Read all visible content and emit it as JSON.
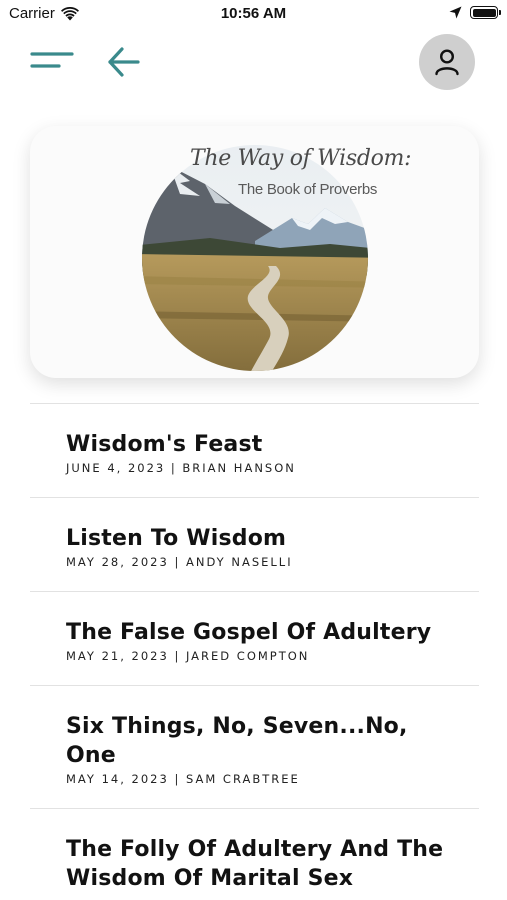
{
  "status_bar": {
    "carrier": "Carrier",
    "time": "10:56 AM"
  },
  "nav": {
    "menu_icon": "menu-icon",
    "back_icon": "arrow-left-icon",
    "profile_icon": "user-icon",
    "accent_color": "#3a8a8c"
  },
  "series": {
    "title": "The Way of Wisdom:",
    "subtitle": "The Book of Proverbs"
  },
  "sermons": [
    {
      "title": "Wisdom's Feast",
      "meta": "JUNE 4, 2023 | BRIAN HANSON"
    },
    {
      "title": "Listen To Wisdom",
      "meta": "MAY 28, 2023 | ANDY NASELLI"
    },
    {
      "title": "The False Gospel Of Adultery",
      "meta": "MAY 21, 2023 | JARED COMPTON"
    },
    {
      "title": "Six Things, No, Seven...No, One",
      "meta": "MAY 14, 2023 | SAM CRABTREE"
    },
    {
      "title": "The Folly Of Adultery And The Wisdom Of Marital Sex",
      "meta": ""
    }
  ]
}
